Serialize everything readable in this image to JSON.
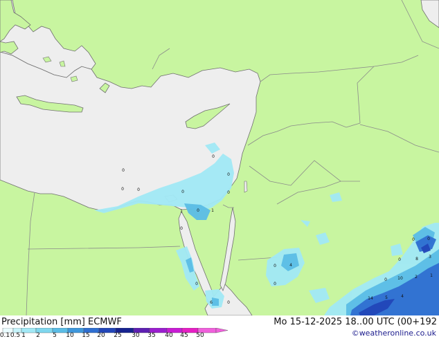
{
  "footer": {
    "title": "Precipitation [mm]  ECMWF",
    "datetime": "Mo 15-12-2025 18..00 UTC (00+192",
    "credit": "©weatheronline.co.uk"
  },
  "colors": {
    "land": "#c8f5a0",
    "sea": "#eeeeee",
    "border": "#8a8a8a",
    "coast": "#6f6f6f"
  },
  "legend": {
    "ticks": [
      "0.1",
      "0.5",
      "1",
      "2",
      "5",
      "10",
      "15",
      "20",
      "25",
      "30",
      "35",
      "40",
      "45",
      "50"
    ],
    "colors": [
      "#eafcff",
      "#c6f4fb",
      "#a2e9f6",
      "#7fd7ee",
      "#5bbde6",
      "#3e97dc",
      "#2f6fd1",
      "#2246b8",
      "#16228f",
      "#5e1fb2",
      "#9a1ecf",
      "#c81bd4",
      "#e61fc4",
      "#f060dc"
    ]
  },
  "map": {
    "grid_values": [
      {
        "label": "0"
      },
      {
        "label": "0"
      },
      {
        "label": "0"
      },
      {
        "label": "0"
      },
      {
        "label": "0"
      },
      {
        "label": "0"
      },
      {
        "label": "0"
      },
      {
        "label": "1"
      },
      {
        "label": "0"
      },
      {
        "label": "1"
      },
      {
        "label": "0"
      },
      {
        "label": "0"
      },
      {
        "label": "0"
      },
      {
        "label": "6"
      },
      {
        "label": "0"
      },
      {
        "label": "0"
      },
      {
        "label": "4"
      },
      {
        "label": "0"
      },
      {
        "label": "0"
      },
      {
        "label": "0"
      },
      {
        "label": "8"
      },
      {
        "label": "3"
      },
      {
        "label": "0"
      },
      {
        "label": "10"
      },
      {
        "label": "2"
      },
      {
        "label": "1"
      },
      {
        "label": "14"
      },
      {
        "label": "5"
      },
      {
        "label": "4"
      }
    ]
  }
}
